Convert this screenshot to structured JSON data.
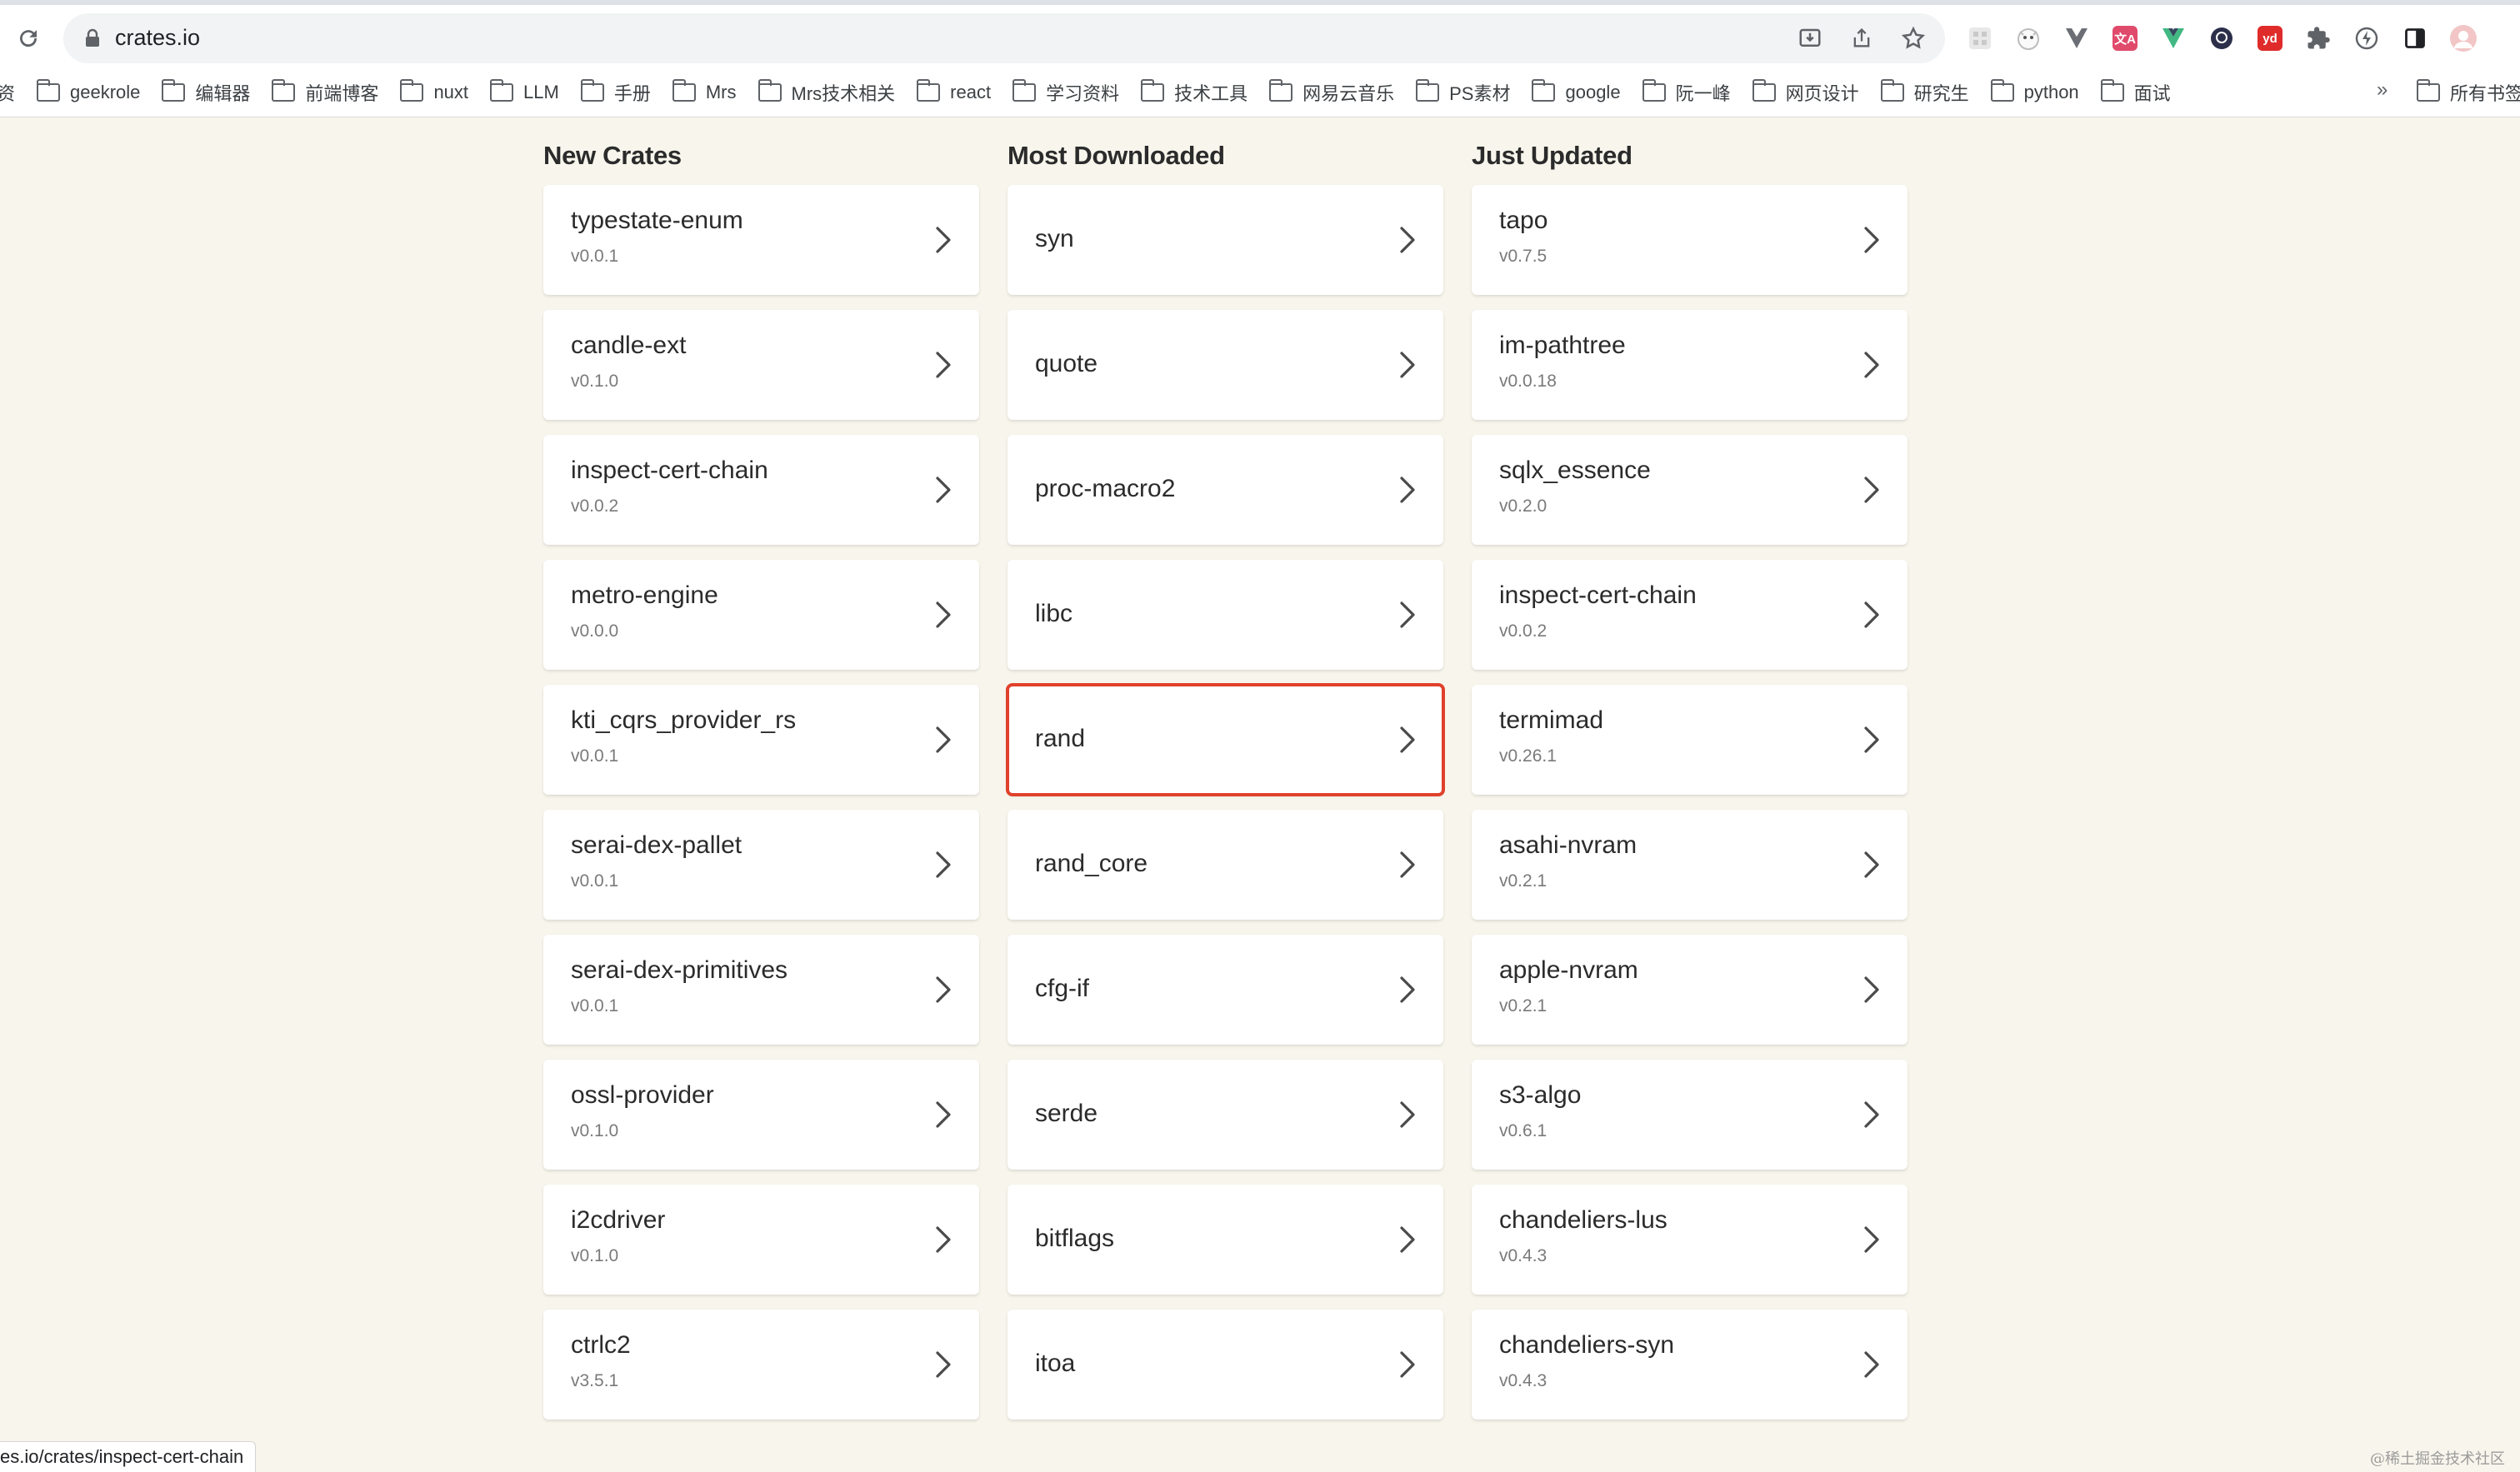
{
  "browser": {
    "url": "crates.io",
    "bookmarks": [
      "资",
      "geekrole",
      "编辑器",
      "前端博客",
      "nuxt",
      "LLM",
      "手册",
      "Mrs",
      "Mrs技术相关",
      "react",
      "学习资料",
      "技术工具",
      "网易云音乐",
      "PS素材",
      "google",
      "阮一峰",
      "网页设计",
      "研究生",
      "python",
      "面试"
    ],
    "bookmarks_more": "»",
    "bookmarks_tail": "所有书签",
    "extensions": [
      {
        "icon": "grid-extension-icon",
        "label": ""
      },
      {
        "icon": "cat-extension-icon",
        "label": ""
      },
      {
        "icon": "vue-devtools-dark-icon",
        "label": ""
      },
      {
        "icon": "translate-extension-icon",
        "label": "文A",
        "color": "#e04a6b"
      },
      {
        "icon": "vue-devtools-icon",
        "label": "",
        "color": "#42b883"
      },
      {
        "icon": "github-extension-icon",
        "label": ""
      },
      {
        "icon": "youdao-extension-icon",
        "label": "yd",
        "color": "#e02b2b"
      },
      {
        "icon": "puzzle-extensions-icon",
        "label": ""
      },
      {
        "icon": "lightning-extension-icon",
        "label": ""
      },
      {
        "icon": "sidepanel-icon",
        "label": ""
      },
      {
        "icon": "profile-avatar-icon",
        "label": ""
      }
    ]
  },
  "columns": [
    {
      "title": "New Crates",
      "crates": [
        {
          "name": "typestate-enum",
          "version": "v0.0.1"
        },
        {
          "name": "candle-ext",
          "version": "v0.1.0"
        },
        {
          "name": "inspect-cert-chain",
          "version": "v0.0.2"
        },
        {
          "name": "metro-engine",
          "version": "v0.0.0"
        },
        {
          "name": "kti_cqrs_provider_rs",
          "version": "v0.0.1"
        },
        {
          "name": "serai-dex-pallet",
          "version": "v0.0.1"
        },
        {
          "name": "serai-dex-primitives",
          "version": "v0.0.1"
        },
        {
          "name": "ossl-provider",
          "version": "v0.1.0"
        },
        {
          "name": "i2cdriver",
          "version": "v0.1.0"
        },
        {
          "name": "ctrlc2",
          "version": "v3.5.1"
        }
      ]
    },
    {
      "title": "Most Downloaded",
      "crates": [
        {
          "name": "syn",
          "version": ""
        },
        {
          "name": "quote",
          "version": ""
        },
        {
          "name": "proc-macro2",
          "version": ""
        },
        {
          "name": "libc",
          "version": ""
        },
        {
          "name": "rand",
          "version": "",
          "highlighted": true
        },
        {
          "name": "rand_core",
          "version": ""
        },
        {
          "name": "cfg-if",
          "version": ""
        },
        {
          "name": "serde",
          "version": ""
        },
        {
          "name": "bitflags",
          "version": ""
        },
        {
          "name": "itoa",
          "version": ""
        }
      ]
    },
    {
      "title": "Just Updated",
      "crates": [
        {
          "name": "tapo",
          "version": "v0.7.5"
        },
        {
          "name": "im-pathtree",
          "version": "v0.0.18"
        },
        {
          "name": "sqlx_essence",
          "version": "v0.2.0"
        },
        {
          "name": "inspect-cert-chain",
          "version": "v0.0.2"
        },
        {
          "name": "termimad",
          "version": "v0.26.1"
        },
        {
          "name": "asahi-nvram",
          "version": "v0.2.1"
        },
        {
          "name": "apple-nvram",
          "version": "v0.2.1"
        },
        {
          "name": "s3-algo",
          "version": "v0.6.1"
        },
        {
          "name": "chandeliers-lus",
          "version": "v0.4.3"
        },
        {
          "name": "chandeliers-syn",
          "version": "v0.4.3"
        }
      ]
    }
  ],
  "colors": {
    "page_bg": "#f8f6ec",
    "highlight": "#e0412c",
    "card_bg": "#ffffff"
  },
  "status_url": "es.io/crates/inspect-cert-chain",
  "watermark": "@稀土掘金技术社区"
}
